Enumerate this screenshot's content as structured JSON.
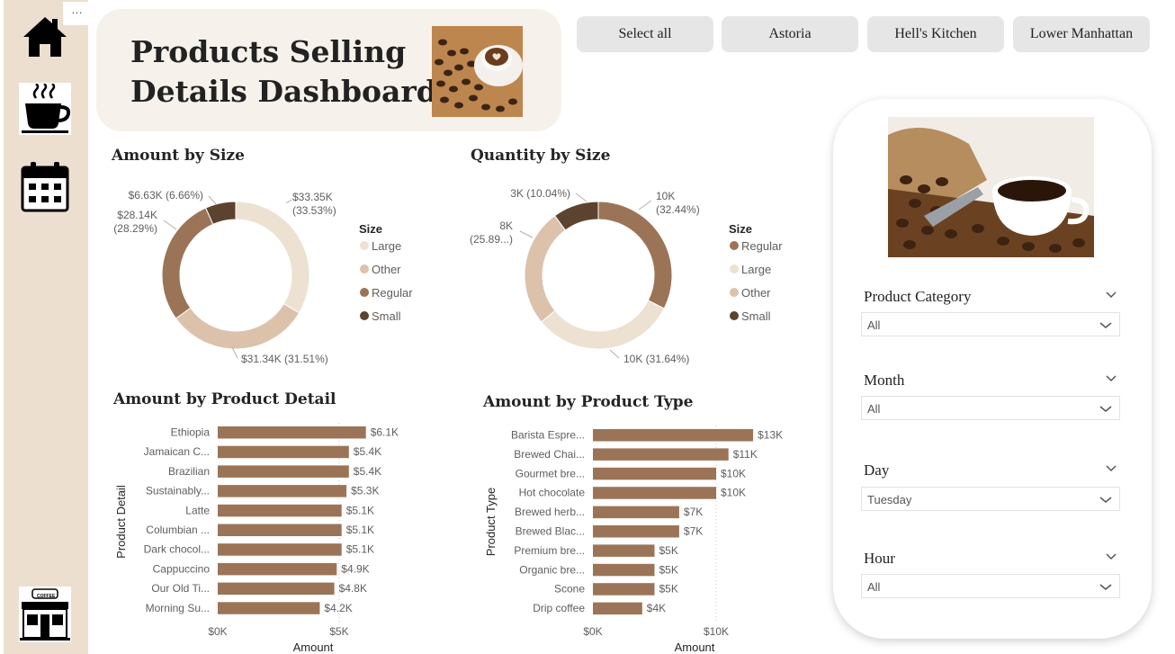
{
  "header": {
    "title_line1": "Products Selling",
    "title_line2": "Details Dashboard"
  },
  "nav": {
    "more_label": "…",
    "icons": [
      "home-icon",
      "coffee-cup-icon",
      "calendar-icon",
      "coffee-shop-icon"
    ],
    "shop_sign": "COFFEE"
  },
  "locations": [
    "Select all",
    "Astoria",
    "Hell's Kitchen",
    "Lower Manhattan"
  ],
  "filters": [
    {
      "title": "Product Category",
      "value": "All"
    },
    {
      "title": "Month",
      "value": "All"
    },
    {
      "title": "Day",
      "value": "Tuesday"
    },
    {
      "title": "Hour",
      "value": "All"
    }
  ],
  "colors": {
    "large": "#ede1d1",
    "other": "#dcc2ab",
    "regular": "#9b7457",
    "small": "#5c4330",
    "bar": "#9b7457",
    "rail": "#ecdfd0"
  },
  "chart_data": [
    {
      "type": "pie",
      "title": "Amount by Size",
      "legend_title": "Size",
      "legend_position": "right",
      "legend": [
        "Large",
        "Other",
        "Regular",
        "Small"
      ],
      "slices": [
        {
          "name": "Large",
          "value": 33.35,
          "label": "$33.35K",
          "pct": "(33.53%)",
          "color": "#ede1d1"
        },
        {
          "name": "Other",
          "value": 31.34,
          "label": "$31.34K (31.51%)",
          "pct": "",
          "color": "#dcc2ab"
        },
        {
          "name": "Regular",
          "value": 28.14,
          "label": "$28.14K",
          "pct": "(28.29%)",
          "color": "#9b7457"
        },
        {
          "name": "Small",
          "value": 6.63,
          "label": "$6.63K (6.66%)",
          "pct": "",
          "color": "#5c4330"
        }
      ]
    },
    {
      "type": "pie",
      "title": "Quantity by Size",
      "legend_title": "Size",
      "legend_position": "right",
      "legend": [
        "Regular",
        "Large",
        "Other",
        "Small"
      ],
      "slices": [
        {
          "name": "Regular",
          "value": 32.44,
          "label": "10K",
          "pct": "(32.44%)",
          "color": "#9b7457"
        },
        {
          "name": "Large",
          "value": 31.64,
          "label": "10K (31.64%)",
          "pct": "",
          "color": "#ede1d1"
        },
        {
          "name": "Other",
          "value": 25.89,
          "label": "8K",
          "pct": "(25.89...)",
          "color": "#dcc2ab"
        },
        {
          "name": "Small",
          "value": 10.04,
          "label": "3K (10.04%)",
          "pct": "",
          "color": "#5c4330"
        }
      ]
    },
    {
      "type": "bar",
      "orientation": "horizontal",
      "title": "Amount by Product Detail",
      "xlabel": "Amount",
      "ylabel": "Product Detail",
      "xlim": [
        0,
        7500
      ],
      "xticks": [
        {
          "value": 0,
          "label": "$0K"
        },
        {
          "value": 5000,
          "label": "$5K"
        }
      ],
      "gridlines": "vertical-dotted",
      "categories": [
        "Ethiopia",
        "Jamaican C...",
        "Brazilian",
        "Sustainably...",
        "Latte",
        "Columbian ...",
        "Dark chocol...",
        "Cappuccino",
        "Our Old Ti...",
        "Morning Su..."
      ],
      "values": [
        6100,
        5400,
        5400,
        5300,
        5100,
        5100,
        5100,
        4900,
        4800,
        4200
      ],
      "labels": [
        "$6.1K",
        "$5.4K",
        "$5.4K",
        "$5.3K",
        "$5.1K",
        "$5.1K",
        "$5.1K",
        "$4.9K",
        "$4.8K",
        "$4.2K"
      ]
    },
    {
      "type": "bar",
      "orientation": "horizontal",
      "title": "Amount by Product Type",
      "xlabel": "Amount",
      "ylabel": "Product Type",
      "xlim": [
        0,
        14000
      ],
      "xticks": [
        {
          "value": 0,
          "label": "$0K"
        },
        {
          "value": 10000,
          "label": "$10K"
        }
      ],
      "gridlines": "vertical-dotted",
      "categories": [
        "Barista Espre...",
        "Brewed Chai...",
        "Gourmet bre...",
        "Hot chocolate",
        "Brewed herb...",
        "Brewed Blac...",
        "Premium bre...",
        "Organic bre...",
        "Scone",
        "Drip coffee"
      ],
      "values": [
        13000,
        11000,
        10000,
        10000,
        7000,
        7000,
        5000,
        5000,
        5000,
        4000
      ],
      "labels": [
        "$13K",
        "$11K",
        "$10K",
        "$10K",
        "$7K",
        "$7K",
        "$5K",
        "$5K",
        "$5K",
        "$4K"
      ]
    }
  ]
}
